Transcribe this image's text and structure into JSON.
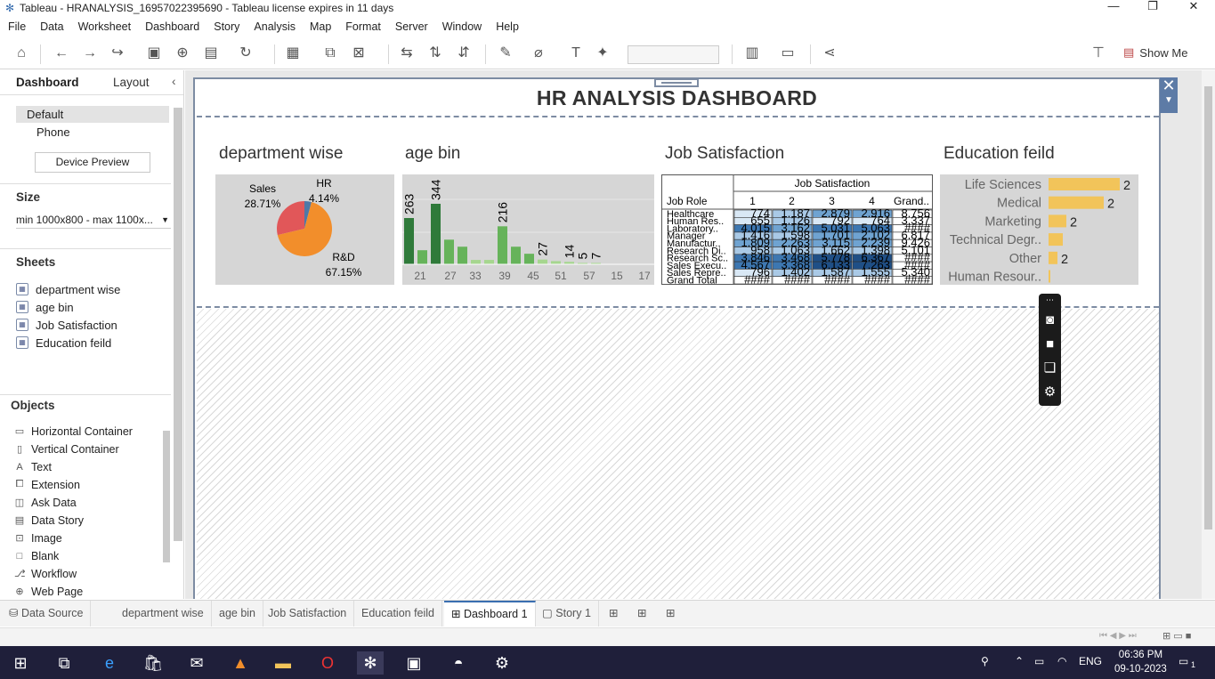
{
  "window": {
    "title": "Tableau - HRANALYSIS_16957022395690 - Tableau license expires in 11 days"
  },
  "menu": [
    "File",
    "Data",
    "Worksheet",
    "Dashboard",
    "Story",
    "Analysis",
    "Map",
    "Format",
    "Server",
    "Window",
    "Help"
  ],
  "toolbar": {
    "show_me_label": "Show Me"
  },
  "left_pane": {
    "tab_dashboard": "Dashboard",
    "tab_layout": "Layout",
    "devices": [
      "Default",
      "Phone"
    ],
    "device_preview_label": "Device Preview",
    "size_title": "Size",
    "size_value": "min 1000x800 - max 1100x...",
    "sheets_title": "Sheets",
    "sheets": [
      "department wise",
      "age bin",
      "Job Satisfaction",
      "Education feild"
    ],
    "objects_title": "Objects",
    "objects": [
      {
        "label": "Horizontal Container",
        "icon": "horizontal-container-icon"
      },
      {
        "label": "Vertical Container",
        "icon": "vertical-container-icon"
      },
      {
        "label": "Text",
        "icon": "text-icon"
      },
      {
        "label": "Extension",
        "icon": "extension-icon"
      },
      {
        "label": "Ask Data",
        "icon": "ask-data-icon"
      },
      {
        "label": "Data Story",
        "icon": "data-story-icon"
      },
      {
        "label": "Image",
        "icon": "image-icon"
      },
      {
        "label": "Blank",
        "icon": "blank-icon"
      },
      {
        "label": "Workflow",
        "icon": "workflow-icon"
      },
      {
        "label": "Web Page",
        "icon": "web-page-icon"
      }
    ]
  },
  "dashboard": {
    "title": "HR ANALYSIS DASHBOARD",
    "sheet_titles": {
      "department": "department wise",
      "age": "age bin",
      "job": "Job Satisfaction",
      "education": "Education feild"
    }
  },
  "chart_data": [
    {
      "type": "pie",
      "categories": [
        "Sales",
        "HR",
        "R&D"
      ],
      "values": [
        28.71,
        4.14,
        67.15
      ],
      "labels": [
        "28.71%",
        "4.14%",
        "67.15%"
      ],
      "colors": [
        "#e15759",
        "#4e79a7",
        "#f28e2b"
      ]
    },
    {
      "type": "bar",
      "x_tick_labels": [
        "21",
        "27",
        "33",
        "39",
        "45",
        "51",
        "57",
        "15",
        "17"
      ],
      "values": [
        263,
        80,
        344,
        140,
        100,
        25,
        25,
        216,
        100,
        60,
        27,
        18,
        14,
        5,
        7
      ],
      "data_labels": [
        "263",
        "344",
        "216",
        "27",
        "14",
        "5",
        "7"
      ],
      "colors": {
        "dark": "#2f7a3a",
        "mid": "#66b35a",
        "light": "#a6d68f"
      }
    },
    {
      "type": "table",
      "column_header": "Job Satisfaction",
      "row_header": "Job Role",
      "columns": [
        "1",
        "2",
        "3",
        "4",
        "Grand.."
      ],
      "rows": [
        {
          "role": "Healthcare",
          "cells": [
            "774",
            "1,187",
            "2,879",
            "2,916",
            "8,756"
          ]
        },
        {
          "role": "Human Res..",
          "cells": [
            "655",
            "1,126",
            "792",
            "764",
            "3,337"
          ]
        },
        {
          "role": "Laboratory..",
          "cells": [
            "4,015",
            "3,162",
            "5,031",
            "5,063",
            "####"
          ]
        },
        {
          "role": "Manager",
          "cells": [
            "1,416",
            "1,598",
            "1,701",
            "2,102",
            "6,817"
          ]
        },
        {
          "role": "Manufactur..",
          "cells": [
            "1,809",
            "2,263",
            "3,115",
            "2,239",
            "9,426"
          ]
        },
        {
          "role": "Research Di..",
          "cells": [
            "958",
            "1,063",
            "1,662",
            "1,398",
            "5,101"
          ]
        },
        {
          "role": "Research Sc..",
          "cells": [
            "3,846",
            "3,468",
            "5,778",
            "6,367",
            "####"
          ]
        },
        {
          "role": "Sales Execu..",
          "cells": [
            "4,567",
            "3,368",
            "6,133",
            "7,263",
            "####"
          ]
        },
        {
          "role": "Sales Repre..",
          "cells": [
            "796",
            "1,402",
            "1,587",
            "1,555",
            "5,340"
          ]
        },
        {
          "role": "Grand Total",
          "cells": [
            "####",
            "####",
            "####",
            "####",
            "####"
          ]
        }
      ]
    },
    {
      "type": "bar",
      "orientation": "horizontal",
      "categories": [
        "Life Sciences",
        "Medical",
        "Marketing",
        "Technical Degr..",
        "Other",
        "Human Resour.."
      ],
      "values": [
        80,
        62,
        20,
        16,
        10,
        2
      ],
      "data_labels": [
        "2",
        "2",
        "2",
        "",
        "2",
        ""
      ],
      "color": "#f2c45a"
    }
  ],
  "sheet_tabs": [
    "Data Source",
    "department wise",
    "age bin",
    "Job Satisfaction",
    "Education feild",
    "Dashboard 1",
    "Story 1"
  ],
  "taskbar": {
    "language": "ENG",
    "time": "06:36 PM",
    "date": "09-10-2023",
    "notification_count": "1"
  }
}
